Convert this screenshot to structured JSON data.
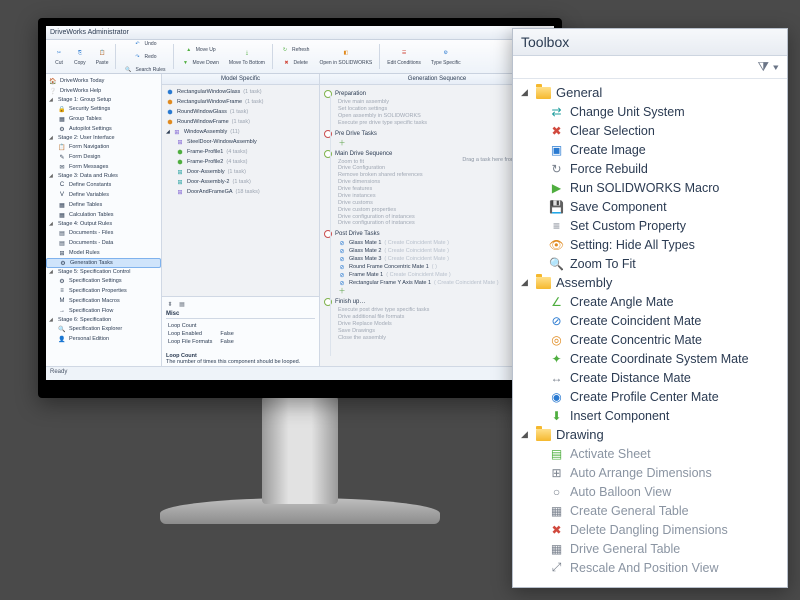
{
  "app_title": "DriveWorks Administrator",
  "ribbon": {
    "cut": "Cut",
    "copy": "Copy",
    "paste": "Paste",
    "undo": "Undo",
    "redo": "Redo",
    "search_rules": "Search Rules",
    "move_up": "Move Up",
    "move_down": "Move Down",
    "move_to_bottom": "Move To Bottom",
    "refresh": "Refresh",
    "delete": "Delete",
    "open_sw": "Open in SOLIDWORKS",
    "edit_conditions": "Edit Conditions",
    "type_specific": "Type Specific"
  },
  "nav": [
    {
      "label": "DriveWorks Today",
      "icon": "🏠",
      "d": 0
    },
    {
      "label": "DriveWorks Help",
      "icon": "❔",
      "d": 0
    },
    {
      "label": "Stage 1: Group Setup",
      "hdr": true,
      "d": 0
    },
    {
      "label": "Security Settings",
      "icon": "🔒",
      "d": 1
    },
    {
      "label": "Group Tables",
      "icon": "▦",
      "d": 1
    },
    {
      "label": "Autopilot Settings",
      "icon": "⚙",
      "d": 1
    },
    {
      "label": "Stage 2: User Interface",
      "hdr": true,
      "d": 0
    },
    {
      "label": "Form Navigation",
      "icon": "📋",
      "d": 1
    },
    {
      "label": "Form Design",
      "icon": "✎",
      "d": 1
    },
    {
      "label": "Form Messages",
      "icon": "✉",
      "d": 1
    },
    {
      "label": "Stage 3: Data and Rules",
      "hdr": true,
      "d": 0
    },
    {
      "label": "Define Constants",
      "icon": "C",
      "d": 1
    },
    {
      "label": "Define Variables",
      "icon": "V",
      "d": 1
    },
    {
      "label": "Define Tables",
      "icon": "▦",
      "d": 1
    },
    {
      "label": "Calculation Tables",
      "icon": "▦",
      "d": 1
    },
    {
      "label": "Stage 4: Output Rules",
      "hdr": true,
      "d": 0
    },
    {
      "label": "Documents - Files",
      "icon": "▤",
      "d": 1
    },
    {
      "label": "Documents - Data",
      "icon": "▤",
      "d": 1
    },
    {
      "label": "Model Rules",
      "icon": "⊞",
      "d": 1
    },
    {
      "label": "Generation Tasks",
      "icon": "⚙",
      "d": 1,
      "sel": true
    },
    {
      "label": "Stage 5: Specification Control",
      "hdr": true,
      "d": 0
    },
    {
      "label": "Specification Settings",
      "icon": "⚙",
      "d": 1
    },
    {
      "label": "Specification Properties",
      "icon": "≡",
      "d": 1
    },
    {
      "label": "Specification Macros",
      "icon": "M",
      "d": 1
    },
    {
      "label": "Specification Flow",
      "icon": "→",
      "d": 1
    },
    {
      "label": "Stage 6: Specification",
      "hdr": true,
      "d": 0
    },
    {
      "label": "Specification Explorer",
      "icon": "🔍",
      "d": 1
    },
    {
      "label": "Personal Edition",
      "icon": "👤",
      "d": 1
    }
  ],
  "mid_header": "Model Specific",
  "models": [
    {
      "label": "RectangularWindowGlass",
      "tail": "(1 task)",
      "icon": "⬢",
      "c": "c-blue"
    },
    {
      "label": "RectangularWindowFrame",
      "tail": "(1 task)",
      "icon": "⬢",
      "c": "c-orange"
    },
    {
      "label": "RoundWindowGlass",
      "tail": "(1 task)",
      "icon": "⬢",
      "c": "c-blue"
    },
    {
      "label": "RoundWindowFrame",
      "tail": "(1 task)",
      "icon": "⬢",
      "c": "c-orange"
    },
    {
      "label": "WindowAssembly",
      "tail": "(11)",
      "icon": "⊞",
      "c": "c-violet",
      "exp": true
    },
    {
      "label": "SteelDoor-WindowAssembly",
      "tail": "",
      "icon": "⊞",
      "c": "c-violet",
      "d": 1
    },
    {
      "label": "Frame-Profile1",
      "tail": "(4 tasks)",
      "icon": "⬢",
      "c": "c-green",
      "d": 1
    },
    {
      "label": "Frame-Profile2",
      "tail": "(4 tasks)",
      "icon": "⬢",
      "c": "c-green",
      "d": 1
    },
    {
      "label": "Door-Assembly",
      "tail": "(1 task)",
      "icon": "⊞",
      "c": "c-teal",
      "d": 1
    },
    {
      "label": "Door-Assembly-2",
      "tail": "(1 task)",
      "icon": "⊞",
      "c": "c-teal",
      "d": 1
    },
    {
      "label": "DoorAndFrameGA",
      "tail": "(18 tasks)",
      "icon": "⊞",
      "c": "c-violet",
      "d": 1
    }
  ],
  "props": {
    "section": "Misc",
    "rows": [
      [
        "Loop Count",
        ""
      ],
      [
        "Loop Enabled",
        "False"
      ],
      [
        "Loop File Formats",
        "False"
      ]
    ],
    "hint_title": "Loop Count",
    "hint_text": "The number of times this component should be looped."
  },
  "gen_header": "Generation Sequence",
  "gen": {
    "prep": {
      "head": "Preparation",
      "items": [
        "Drive main assembly",
        "Set location settings",
        "Open assembly in SOLIDWORKS",
        "Execute pre drive type specific tasks"
      ]
    },
    "pre": {
      "head": "Pre Drive Tasks",
      "hint": "Drag a task here from the toolbox"
    },
    "main": {
      "head": "Main Drive Sequence",
      "items": [
        "Zoom to fit",
        "Drive Configuration",
        "Remove broken shared references",
        "Drive dimensions",
        "Drive features",
        "Drive instances",
        "Drive customs",
        "Drive custom properties",
        "Drive configuration of instances",
        "Drive configuration of instances"
      ]
    },
    "post": {
      "head": "Post Drive Tasks",
      "mates": [
        {
          "label": "Glass Mate 1",
          "tail": "( Create Coincident Mate )"
        },
        {
          "label": "Glass Mate 2",
          "tail": "( Create Coincident Mate )"
        },
        {
          "label": "Glass Mate 3",
          "tail": "( Create Coincident Mate )"
        },
        {
          "label": "Round Frame Concentric Mate 1",
          "tail": "( )"
        },
        {
          "label": "Frame Mate 1",
          "tail": "( Create Coincident Mate )"
        },
        {
          "label": "Rectangular Frame Y Axis Mate 1",
          "tail": "( Create Coincident Mate )"
        }
      ]
    },
    "finish": {
      "head": "Finish up…",
      "items": [
        "Execute post drive type specific tasks",
        "Drive additional file formats",
        "Drive Replace Models",
        "Save Drawings",
        "Close the assembly"
      ]
    }
  },
  "status": "Ready",
  "toolbox": {
    "title": "Toolbox",
    "groups": [
      {
        "name": "General",
        "items": [
          {
            "label": "Change Unit System",
            "icon": "⇄",
            "c": "c-teal"
          },
          {
            "label": "Clear Selection",
            "icon": "✖",
            "c": "c-red"
          },
          {
            "label": "Create Image",
            "icon": "▣",
            "c": "c-blue"
          },
          {
            "label": "Force Rebuild",
            "icon": "↻",
            "c": "c-gray"
          },
          {
            "label": "Run SOLIDWORKS Macro",
            "icon": "▶",
            "c": "c-green"
          },
          {
            "label": "Save Component",
            "icon": "💾",
            "c": "c-blue"
          },
          {
            "label": "Set Custom Property",
            "icon": "≡",
            "c": "c-gray"
          },
          {
            "label": "Setting: Hide All Types",
            "icon": "👁",
            "c": "c-orange"
          },
          {
            "label": "Zoom To Fit",
            "icon": "🔍",
            "c": "c-gray"
          }
        ]
      },
      {
        "name": "Assembly",
        "items": [
          {
            "label": "Create Angle Mate",
            "icon": "∠",
            "c": "c-green"
          },
          {
            "label": "Create Coincident Mate",
            "icon": "⊘",
            "c": "c-blue"
          },
          {
            "label": "Create Concentric Mate",
            "icon": "◎",
            "c": "c-orange"
          },
          {
            "label": "Create Coordinate System Mate",
            "icon": "✦",
            "c": "c-green"
          },
          {
            "label": "Create Distance Mate",
            "icon": "↔",
            "c": "c-gray"
          },
          {
            "label": "Create Profile Center Mate",
            "icon": "◉",
            "c": "c-blue"
          },
          {
            "label": "Insert Component",
            "icon": "⬇",
            "c": "c-green"
          }
        ]
      },
      {
        "name": "Drawing",
        "items": [
          {
            "label": "Activate Sheet",
            "icon": "▤",
            "c": "c-green",
            "dim": true
          },
          {
            "label": "Auto Arrange Dimensions",
            "icon": "⊞",
            "c": "c-gray",
            "dim": true
          },
          {
            "label": "Auto Balloon View",
            "icon": "○",
            "c": "c-gray",
            "dim": true
          },
          {
            "label": "Create General Table",
            "icon": "▦",
            "c": "c-gray",
            "dim": true
          },
          {
            "label": "Delete Dangling Dimensions",
            "icon": "✖",
            "c": "c-red",
            "dim": true
          },
          {
            "label": "Drive General Table",
            "icon": "▦",
            "c": "c-gray",
            "dim": true
          },
          {
            "label": "Rescale And Position View",
            "icon": "⤢",
            "c": "c-gray",
            "dim": true
          }
        ]
      }
    ]
  }
}
